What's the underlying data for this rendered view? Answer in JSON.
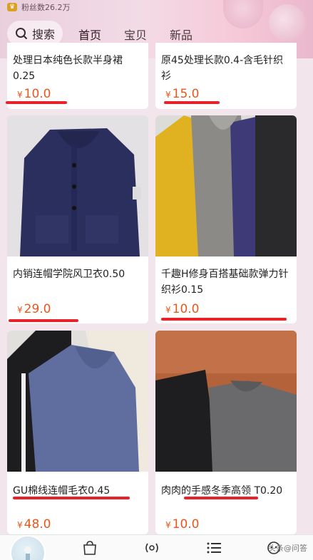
{
  "header": {
    "fans_text": "粉丝数26.2万",
    "search_label": "搜索",
    "tabs": [
      {
        "label": "首页",
        "active": true
      },
      {
        "label": "宝贝",
        "active": false
      },
      {
        "label": "新品",
        "active": false
      }
    ]
  },
  "products": [
    {
      "title": "处理日本纯色长款半身裙0.25",
      "price": "10.0",
      "currency": "¥"
    },
    {
      "title": "原45处理长款0.4-含毛针织衫",
      "price": "15.0",
      "currency": "¥"
    },
    {
      "title": "内销连帽学院风卫衣0.50",
      "price": "29.0",
      "currency": "¥"
    },
    {
      "title": "千趣H修身百搭基础款弹力针织衫0.15",
      "price": "10.0",
      "currency": "¥"
    },
    {
      "title": "GU棉线连帽毛衣0.45",
      "price": "48.0",
      "currency": "¥"
    },
    {
      "title": "肉肉的手感冬季高领 T0.20",
      "price": "10.0",
      "currency": "¥"
    }
  ],
  "watermark": "头条@问答",
  "colors": {
    "price": "#e8571b",
    "underline": "#e8212a"
  }
}
